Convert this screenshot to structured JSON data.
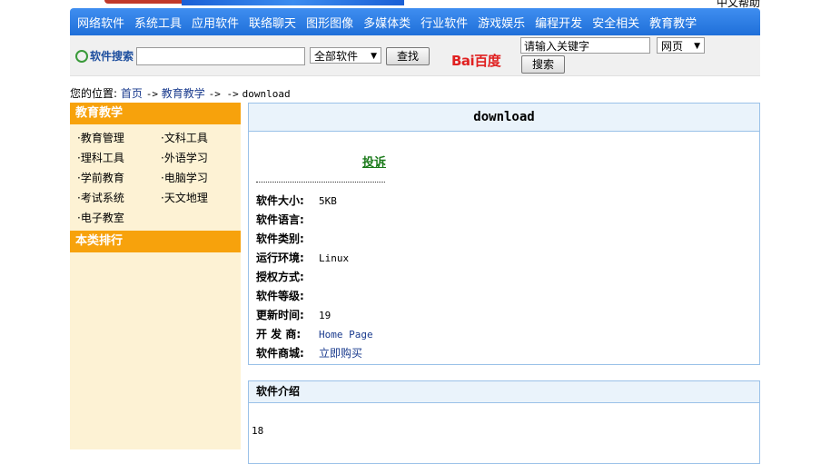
{
  "banner": {
    "right_text": "中文帮助"
  },
  "nav": [
    "网络软件",
    "系统工具",
    "应用软件",
    "联络聊天",
    "图形图像",
    "多媒体类",
    "行业软件",
    "游戏娱乐",
    "编程开发",
    "安全相关",
    "教育教学"
  ],
  "search": {
    "label": "软件搜索",
    "input_value": "",
    "category_selected": "全部软件",
    "search_button": "查找",
    "baidu_logo": "Bai百度",
    "baidu_input": "请输入关键字",
    "baidu_scope": "网页",
    "baidu_button": "搜索"
  },
  "breadcrumb": {
    "prefix": "您的位置:",
    "home": "首页",
    "sep1": "->",
    "category": "教育教学",
    "sep2": "-> ->",
    "current": "download"
  },
  "sidebar": {
    "title": "教育教学",
    "items": [
      "教育管理",
      "文科工具",
      "理科工具",
      "外语学习",
      "学前教育",
      "电脑学习",
      "考试系统",
      "天文地理",
      "电子教室"
    ],
    "title2": "本类排行"
  },
  "detail": {
    "title": "download",
    "report_link": "投诉",
    "fields": [
      {
        "label": "软件大小:",
        "value": "5KB"
      },
      {
        "label": "软件语言:",
        "value": ""
      },
      {
        "label": "软件类别:",
        "value": ""
      },
      {
        "label": "运行环境:",
        "value": "Linux"
      },
      {
        "label": "授权方式:",
        "value": ""
      },
      {
        "label": "软件等级:",
        "value": ""
      },
      {
        "label": "更新时间:",
        "value": "19"
      },
      {
        "label": "开 发 商:",
        "value": "Home Page"
      },
      {
        "label": "软件商城:",
        "value": "立即购买"
      }
    ]
  },
  "intro": {
    "title": "软件介绍",
    "text": "18"
  }
}
